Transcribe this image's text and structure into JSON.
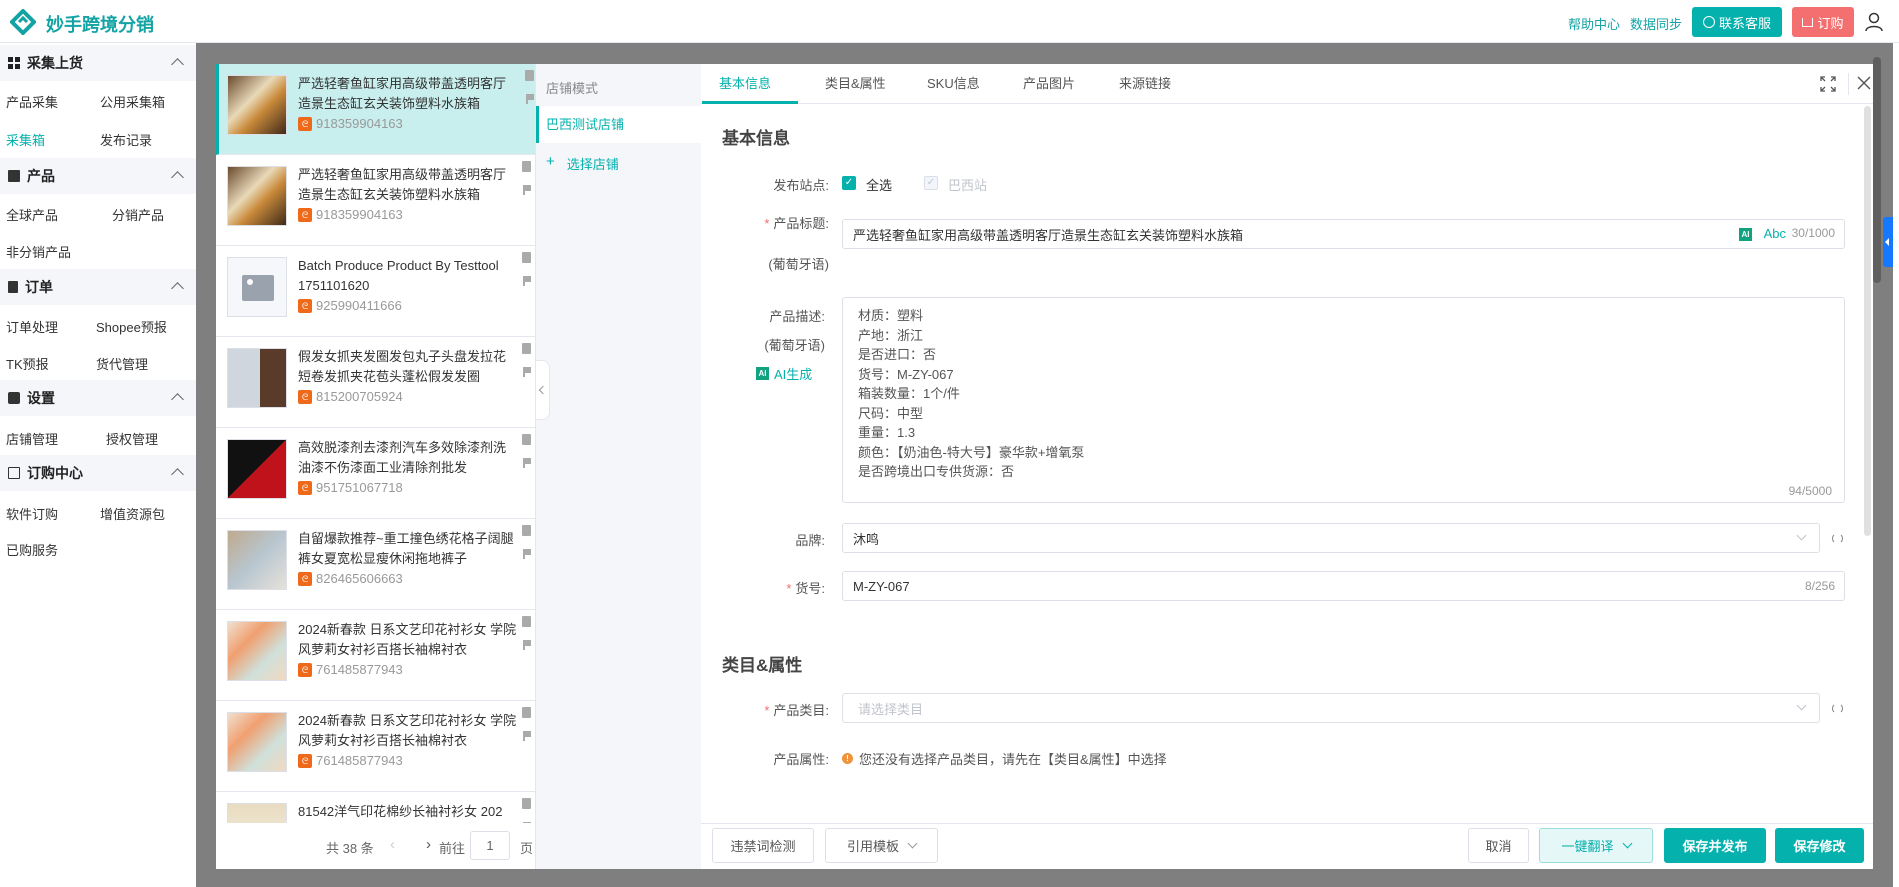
{
  "header": {
    "app_title": "妙手跨境分销",
    "help": "帮助中心",
    "sync": "数据同步",
    "contact": "联系客服",
    "order": "订购",
    "brand_color": "#05b1ad"
  },
  "sidebar": {
    "sections": [
      {
        "title": "采集上货",
        "items": [
          "产品采集",
          "公用采集箱",
          "采集箱",
          "发布记录"
        ]
      },
      {
        "title": "产品",
        "items": [
          "全球产品",
          "分销产品",
          "非分销产品"
        ]
      },
      {
        "title": "订单",
        "items": [
          "订单处理",
          "Shopee预报",
          "TK预报",
          "货代管理"
        ]
      },
      {
        "title": "设置",
        "items": [
          "店铺管理",
          "授权管理"
        ]
      },
      {
        "title": "订购中心",
        "items": [
          "软件订购",
          "增值资源包",
          "已购服务"
        ]
      }
    ],
    "active_item": "采集箱"
  },
  "product_list": {
    "items": [
      {
        "title": "严选轻奢鱼缸家用高级带盖透明客厅造景生态缸玄关装饰塑料水族箱",
        "id": "918359904163"
      },
      {
        "title": "严选轻奢鱼缸家用高级带盖透明客厅造景生态缸玄关装饰塑料水族箱",
        "id": "918359904163"
      },
      {
        "title": "Batch Produce Product By Testtool 1751101620",
        "id": "925990411666"
      },
      {
        "title": "假发女抓夹发圈发包丸子头盘发拉花短卷发抓夹花苞头蓬松假发发圈",
        "id": "815200705924"
      },
      {
        "title": "高效脱漆剂去漆剂汽车多效除漆剂洗油漆不伤漆面工业清除剂批发",
        "id": "951751067718"
      },
      {
        "title": "自留爆款推荐~重工撞色绣花格子阔腿裤女夏宽松显瘦休闲拖地裤子",
        "id": "826465606663"
      },
      {
        "title": "2024新春款 日系文艺印花衬衫女 学院风萝莉女衬衫百搭长袖棉衬衣",
        "id": "761485877943"
      },
      {
        "title": "2024新春款 日系文艺印花衬衫女 学院风萝莉女衬衫百搭长袖棉衬衣",
        "id": "761485877943"
      },
      {
        "title": "81542洋气印花棉纱长袖衬衫女 202",
        "id": ""
      }
    ],
    "pager": {
      "total": "共 38 条",
      "goto": "前往",
      "page": "1",
      "page_suffix": "页"
    }
  },
  "stores": {
    "mode_label": "店铺模式",
    "active_store": "巴西测试店铺",
    "add_store": "选择店铺"
  },
  "tabs": [
    "基本信息",
    "类目&属性",
    "SKU信息",
    "产品图片",
    "来源链接"
  ],
  "form": {
    "section_basic": "基本信息",
    "site_label": "发布站点:",
    "select_all": "全选",
    "site_brazil": "巴西站",
    "title_label": "产品标题:",
    "lang_note": "(葡萄牙语)",
    "title_value": "严选轻奢鱼缸家用高级带盖透明客厅造景生态缸玄关装饰塑料水族箱",
    "ai_badge": "AI",
    "abc": "Abc",
    "title_count": "30/1000",
    "desc_label": "产品描述:",
    "ai_generate": "AI生成",
    "desc_lines": [
      "材质：塑料",
      "产地：浙江",
      "是否进口：否",
      "货号：M-ZY-067",
      "箱装数量：1个/件",
      "尺码：中型",
      "重量：1.3",
      "颜色：【奶油色-特大号】豪华款+增氧泵",
      "是否跨境出口专供货源：否"
    ],
    "desc_count": "94/5000",
    "brand_label": "品牌:",
    "brand_value": "沐鸣",
    "sku_label": "货号:",
    "sku_value": "M-ZY-067",
    "sku_count": "8/256",
    "section_category": "类目&属性",
    "category_label": "产品类目:",
    "category_placeholder": "请选择类目",
    "attr_label": "产品属性:",
    "attr_hint": "您还没有选择产品类目，请先在【类目&属性】中选择"
  },
  "footer": {
    "check": "违禁词检测",
    "template": "引用模板",
    "cancel": "取消",
    "translate": "一键翻译",
    "save_publish": "保存并发布",
    "save": "保存修改"
  }
}
